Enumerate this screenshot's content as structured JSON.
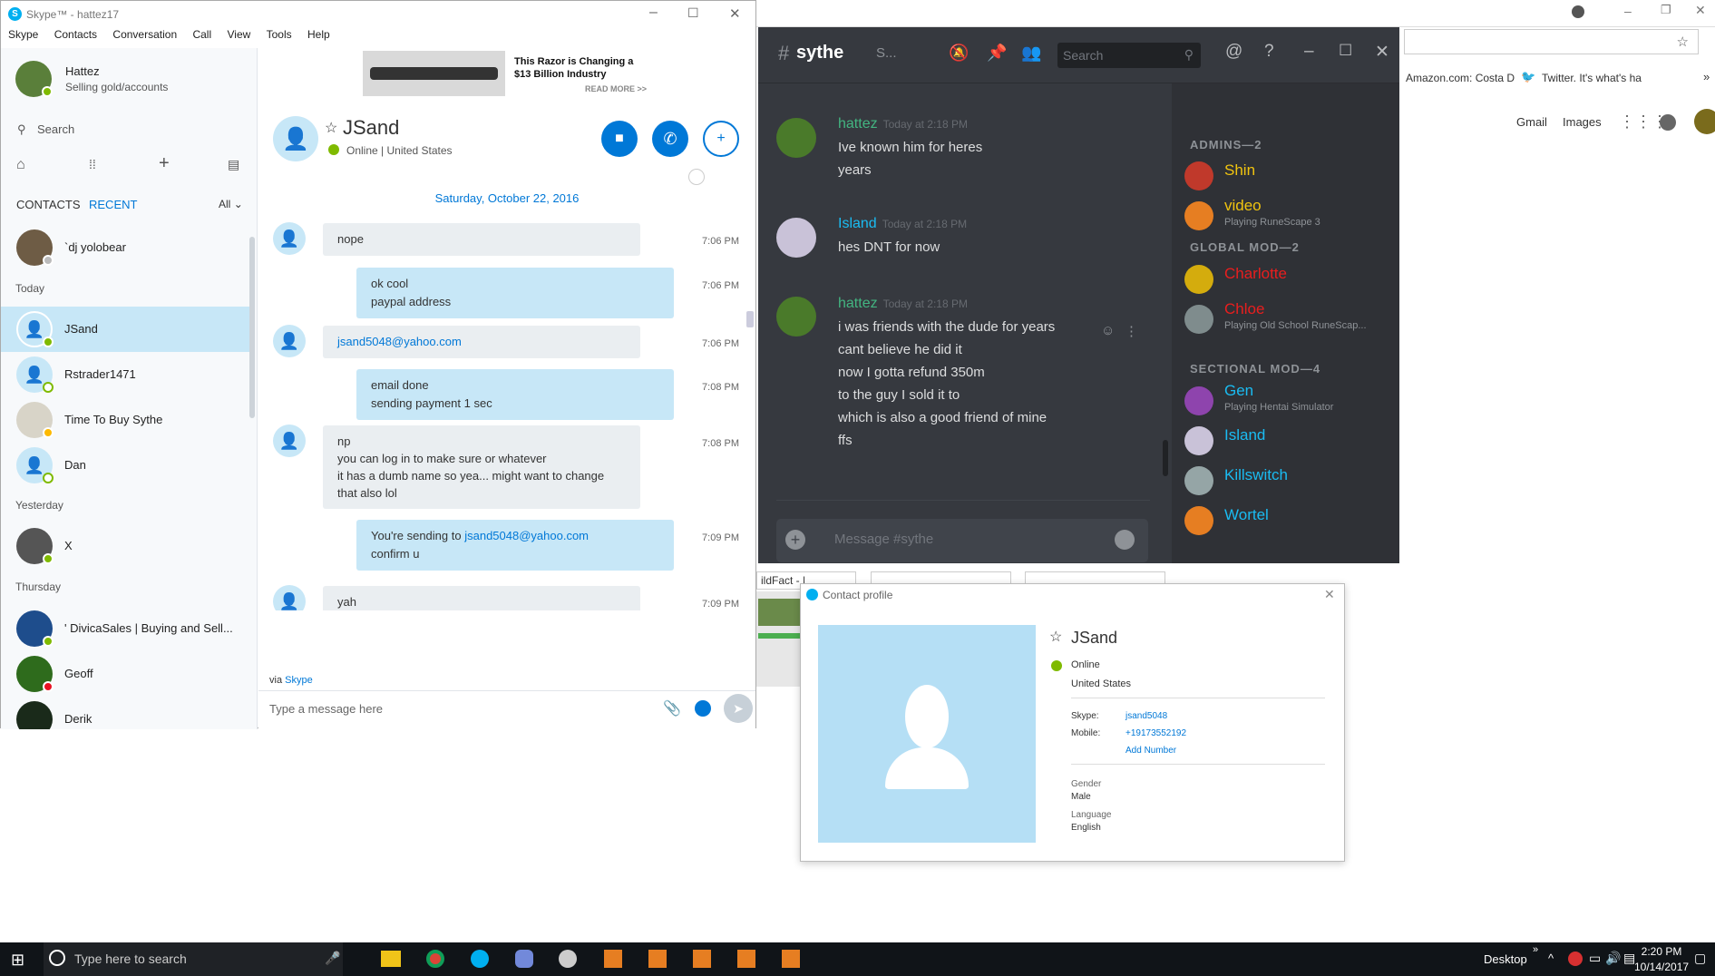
{
  "chrome": {
    "bookmarks": [
      "Amazon.com: Costa D",
      "Twitter. It's what's ha"
    ],
    "links": [
      "Gmail",
      "Images"
    ],
    "tabs_bg": [
      "ildFact - |",
      "",
      ""
    ]
  },
  "skype": {
    "title": "Skype™ - hattez17",
    "menu": [
      "Skype",
      "Contacts",
      "Conversation",
      "Call",
      "View",
      "Tools",
      "Help"
    ],
    "profile": {
      "name": "Hattez",
      "status": "Selling gold/accounts"
    },
    "search_placeholder": "Search",
    "tabs": {
      "contacts": "CONTACTS",
      "recent": "RECENT",
      "filter": "All"
    },
    "groups": {
      "today": "Today",
      "yesterday": "Yesterday",
      "thursday": "Thursday"
    },
    "contacts": [
      {
        "name": "`dj yolobear"
      },
      {
        "name": "JSand"
      },
      {
        "name": "Rstrader1471"
      },
      {
        "name": "Time To Buy Sythe"
      },
      {
        "name": "Dan"
      },
      {
        "name": "X"
      },
      {
        "name": "' DivicaSales | Buying and Sell..."
      },
      {
        "name": "Geoff"
      },
      {
        "name": "Derik"
      }
    ],
    "ad": {
      "headline": "This Razor is Changing a $13 Billion Industry",
      "cta": "READ MORE >>"
    },
    "chat": {
      "name": "JSand",
      "status": "Online",
      "location": "United States",
      "date": "Saturday, October 22, 2016",
      "messages": [
        {
          "lines": [
            "nope"
          ],
          "time": "7:06 PM",
          "me": false
        },
        {
          "lines": [
            "ok cool",
            "paypal address"
          ],
          "time": "7:06 PM",
          "me": true
        },
        {
          "lines": [
            "jsand5048@yahoo.com"
          ],
          "time": "7:06 PM",
          "me": false
        },
        {
          "lines": [
            "email done",
            "sending payment 1 sec"
          ],
          "time": "7:08 PM",
          "me": true
        },
        {
          "lines": [
            "np",
            "you can log in to make sure or whatever",
            "it has a dumb name so yea... might want to change",
            "that also lol"
          ],
          "time": "7:08 PM",
          "me": false
        },
        {
          "lines": [
            "You're sending to",
            "jsand5048@yahoo.com",
            "confirm u"
          ],
          "time": "7:09 PM",
          "me": true
        },
        {
          "lines": [
            "yah"
          ],
          "time": "7:09 PM",
          "me": false
        }
      ],
      "via": "via",
      "via_link": "Skype",
      "input_placeholder": "Type a message here"
    }
  },
  "discord": {
    "channel": "sythe",
    "topic": "S...",
    "search_placeholder": "Search",
    "messages": [
      {
        "author": "hattez",
        "time": "Today at 2:18 PM",
        "color": "#43b581",
        "lines": [
          "Ive known him for heres",
          "years"
        ]
      },
      {
        "author": "Island",
        "time": "Today at 2:18 PM",
        "color": "#1abcf2",
        "lines": [
          "hes DNT for now"
        ]
      },
      {
        "author": "hattez",
        "time": "Today at 2:18 PM",
        "color": "#43b581",
        "lines": [
          "i was friends with the dude for years",
          "cant believe he did it",
          "now I gotta refund 350m",
          "to the guy I sold it to",
          "which is also a good friend of mine",
          "ffs"
        ]
      }
    ],
    "input_placeholder": "Message #sythe",
    "member_groups": [
      {
        "title": "ADMINS—2",
        "members": [
          {
            "name": "Shin",
            "color": "#f1c40f",
            "playing": ""
          },
          {
            "name": "video",
            "color": "#f1c40f",
            "playing": "Playing RuneScape 3"
          }
        ]
      },
      {
        "title": "GLOBAL MOD—2",
        "members": [
          {
            "name": "Charlotte",
            "color": "#e91e1e",
            "playing": ""
          },
          {
            "name": "Chloe",
            "color": "#e91e1e",
            "playing": "Playing Old School RuneScap..."
          }
        ]
      },
      {
        "title": "SECTIONAL MOD—4",
        "members": [
          {
            "name": "Gen",
            "color": "#1abcf2",
            "playing": "Playing Hentai Simulator"
          },
          {
            "name": "Island",
            "color": "#1abcf2",
            "playing": ""
          },
          {
            "name": "Killswitch",
            "color": "#1abcf2",
            "playing": ""
          },
          {
            "name": "Wortel",
            "color": "#1abcf2",
            "playing": ""
          }
        ]
      }
    ]
  },
  "contact_profile": {
    "title": "Contact profile",
    "name": "JSand",
    "status": "Online",
    "location": "United States",
    "skype_label": "Skype:",
    "skype_value": "jsand5048",
    "mobile_label": "Mobile:",
    "mobile_value": "+19173552192",
    "add_number": "Add Number",
    "gender_label": "Gender",
    "gender_value": "Male",
    "language_label": "Language",
    "language_value": "English"
  },
  "taskbar": {
    "search_placeholder": "Type here to search",
    "desktop_label": "Desktop",
    "time": "2:20 PM",
    "date": "10/14/2017"
  }
}
